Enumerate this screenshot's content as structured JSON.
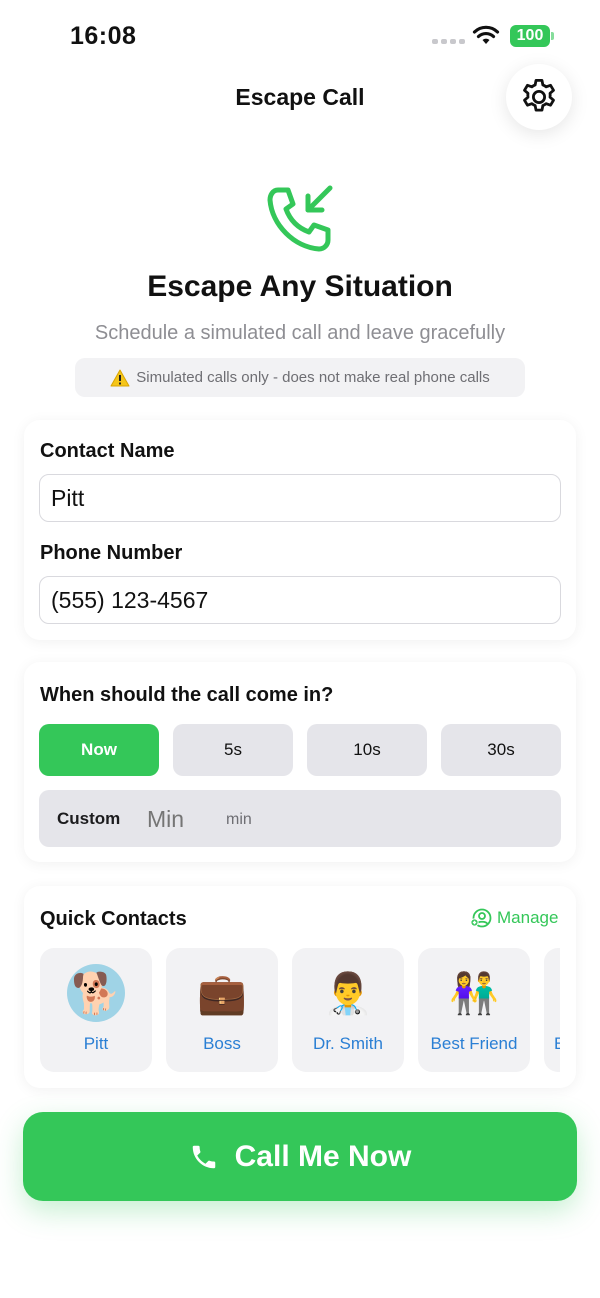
{
  "status_bar": {
    "time": "16:08",
    "battery": "100"
  },
  "nav": {
    "title": "Escape Call",
    "settings_icon": "gear-icon"
  },
  "hero": {
    "icon": "phone-incoming-icon",
    "title": "Escape Any Situation",
    "subtitle": "Schedule a simulated call and leave gracefully",
    "warning": "Simulated calls only - does not make real phone calls"
  },
  "contact_form": {
    "name_label": "Contact Name",
    "name_value": "Pitt",
    "phone_label": "Phone Number",
    "phone_value": "(555) 123-4567"
  },
  "timing": {
    "title": "When should the call come in?",
    "options": [
      "Now",
      "5s",
      "10s",
      "30s"
    ],
    "selected": "Now",
    "custom_label": "Custom",
    "custom_placeholder": "Min",
    "custom_unit": "min"
  },
  "quick_contacts": {
    "title": "Quick Contacts",
    "manage_label": "Manage",
    "contacts": [
      {
        "name": "Pitt",
        "avatar": "🐕"
      },
      {
        "name": "Boss",
        "avatar": "💼"
      },
      {
        "name": "Dr. Smith",
        "avatar": "👨‍⚕️"
      },
      {
        "name": "Best Friend",
        "avatar": "👫"
      },
      {
        "name": "E",
        "avatar": ""
      }
    ]
  },
  "call_button": {
    "label": "Call Me Now",
    "icon": "phone-icon"
  },
  "colors": {
    "accent": "#34c759",
    "link": "#2a7fd4",
    "muted": "#8e8e93"
  }
}
